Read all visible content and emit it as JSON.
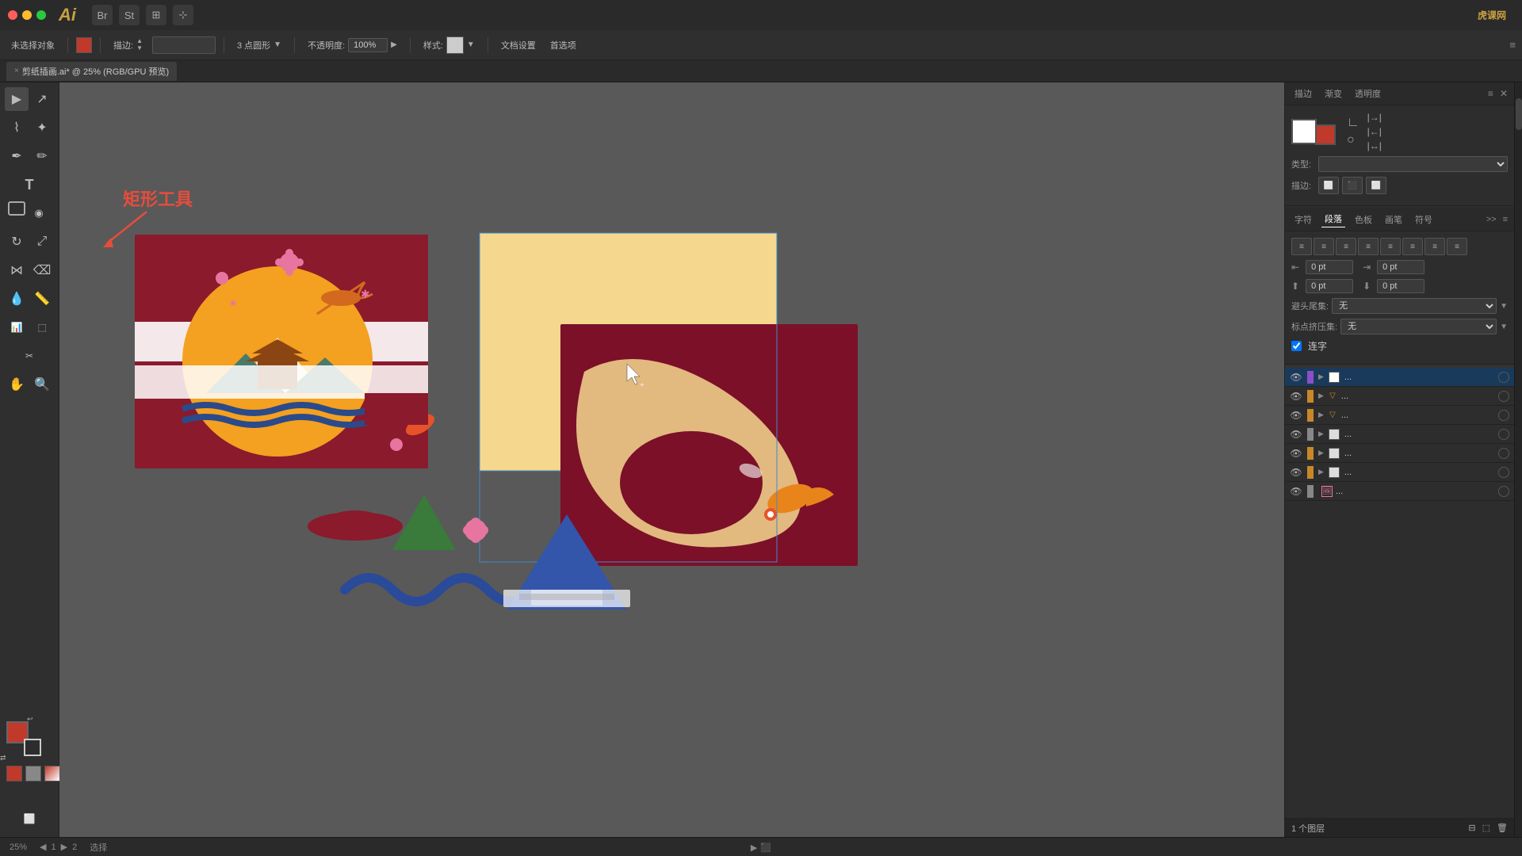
{
  "titlebar": {
    "app_name": "Ai",
    "traffic_lights": [
      "red",
      "yellow",
      "green"
    ],
    "companion_apps": [
      "Br",
      "St",
      ""
    ],
    "right_text": "虎课网"
  },
  "toolbar": {
    "no_selection": "未选择对象",
    "fill_color": "#c0392b",
    "stroke_label": "描边:",
    "stroke_width": "3 点圆形",
    "opacity_label": "不透明度:",
    "opacity_value": "100%",
    "style_label": "样式:",
    "doc_setup": "文档设置",
    "preferences": "首选项"
  },
  "tab": {
    "close": "×",
    "name": "剪纸插画.ai* @ 25% (RGB/GPU 预览)"
  },
  "annotation": {
    "text": "矩形工具"
  },
  "tools": [
    {
      "name": "select",
      "icon": "▶",
      "active": true
    },
    {
      "name": "direct-select",
      "icon": "↗"
    },
    {
      "name": "lasso",
      "icon": "⌇"
    },
    {
      "name": "magic-wand",
      "icon": "✦"
    },
    {
      "name": "pen",
      "icon": "✒"
    },
    {
      "name": "pencil",
      "icon": "✏"
    },
    {
      "name": "type",
      "icon": "T"
    },
    {
      "name": "rectangle",
      "icon": "▭",
      "active": false
    },
    {
      "name": "rotate",
      "icon": "↻"
    },
    {
      "name": "transform",
      "icon": "⤢"
    },
    {
      "name": "blend",
      "icon": "⋈"
    },
    {
      "name": "eyedropper",
      "icon": "⌫"
    },
    {
      "name": "graph",
      "icon": "📊"
    },
    {
      "name": "artboard",
      "icon": "⬚"
    },
    {
      "name": "slice",
      "icon": "✂"
    },
    {
      "name": "hand",
      "icon": "✋"
    },
    {
      "name": "zoom",
      "icon": "🔍"
    }
  ],
  "right_panel": {
    "tabs": [
      "描边",
      "渐变",
      "透明度"
    ],
    "type_label": "类型:",
    "type_value": "",
    "stroke_label": "描边:",
    "align_section": {
      "title": "段落",
      "buttons": [
        "左对齐",
        "居中",
        "右对齐",
        "两端对齐",
        "末行左",
        "末行居中",
        "末行右",
        "分散"
      ]
    },
    "indent_left_label": "0 pt",
    "indent_right_label": "0 pt",
    "space_before": "0 pt",
    "space_after": "0 pt",
    "hyphen_label": "避头尾集:",
    "hyphen_value": "无",
    "compress_label": "标点挤压集:",
    "compress_value": "无",
    "ligature_label": "连字",
    "ligature_checked": true,
    "panel_tabs2": [
      "字符",
      "段落",
      "色板",
      "画笔",
      "符号"
    ]
  },
  "layers": [
    {
      "visible": true,
      "color": "#8b4fc8",
      "expanded": true,
      "icon": "▭",
      "name": "...",
      "circle": true,
      "active": true
    },
    {
      "visible": true,
      "color": "#c8882a",
      "expanded": true,
      "icon": "▽",
      "name": "...",
      "circle": true
    },
    {
      "visible": true,
      "color": "#c8882a",
      "expanded": true,
      "icon": "▽",
      "name": "...",
      "circle": true
    },
    {
      "visible": true,
      "color": "#888",
      "expanded": true,
      "icon": "▭",
      "name": "...",
      "circle": true
    },
    {
      "visible": true,
      "color": "#c8882a",
      "expanded": true,
      "icon": "▭",
      "name": "...",
      "circle": true
    },
    {
      "visible": true,
      "color": "#c8882a",
      "expanded": true,
      "icon": "▭",
      "name": "...",
      "circle": true
    },
    {
      "visible": true,
      "color": "#888",
      "expanded": false,
      "icon": "🖼",
      "name": "...",
      "circle": true
    }
  ],
  "layers_footer": {
    "count": "1 个图层"
  },
  "statusbar": {
    "zoom": "25%",
    "action": "选择"
  },
  "canvas": {
    "bg": "#595959"
  }
}
